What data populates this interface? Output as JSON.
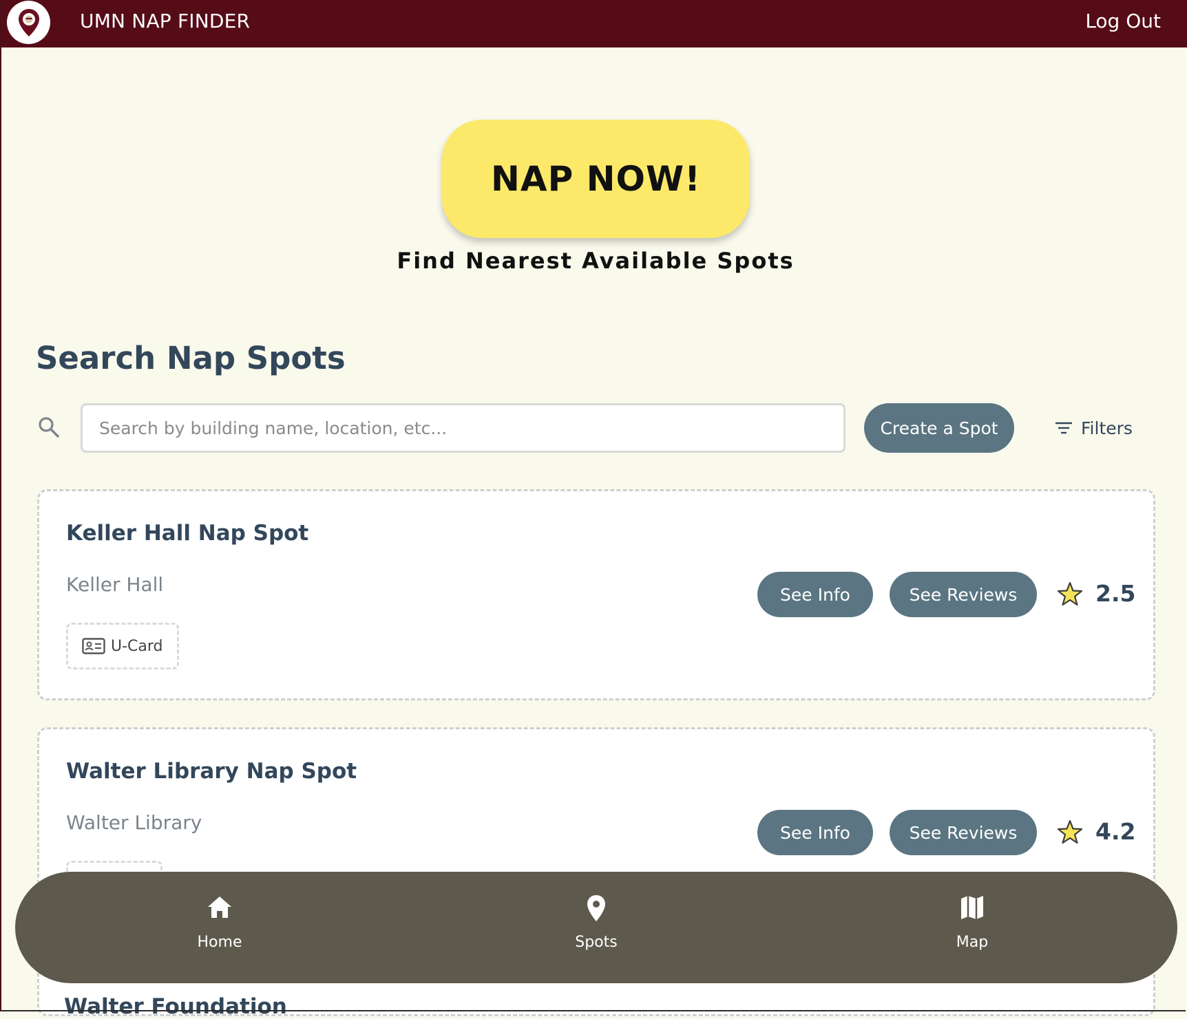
{
  "header": {
    "title": "UMN NAP FINDER",
    "logout_label": "Log Out"
  },
  "hero": {
    "nap_now_label": "NAP NOW!",
    "subtitle": "Find Nearest Available Spots"
  },
  "search": {
    "heading": "Search Nap Spots",
    "placeholder": "Search by building name, location, etc...",
    "value": "",
    "create_label": "Create a Spot",
    "filters_label": "Filters"
  },
  "spots": [
    {
      "title": "Keller Hall Nap Spot",
      "building": "Keller Hall",
      "tags": [
        "U-Card"
      ],
      "see_info_label": "See Info",
      "see_reviews_label": "See Reviews",
      "rating": "2.5"
    },
    {
      "title": "Walter Library Nap Spot",
      "building": "Walter Library",
      "tags": [
        ""
      ],
      "see_info_label": "See Info",
      "see_reviews_label": "See Reviews",
      "rating": "4.2"
    },
    {
      "title": "Walter Foundation"
    }
  ],
  "nav": {
    "items": [
      {
        "label": "Home",
        "icon": "home-icon"
      },
      {
        "label": "Spots",
        "icon": "map-pin-icon"
      },
      {
        "label": "Map",
        "icon": "map-icon"
      }
    ]
  },
  "colors": {
    "header_bg": "#550c17",
    "page_bg": "#f9f9ec",
    "nap_button": "#fce96a",
    "pill_button": "#5b7582",
    "nav_bg": "#5d5a4d",
    "star": "#f5e45a",
    "text_dark": "#33475b"
  }
}
